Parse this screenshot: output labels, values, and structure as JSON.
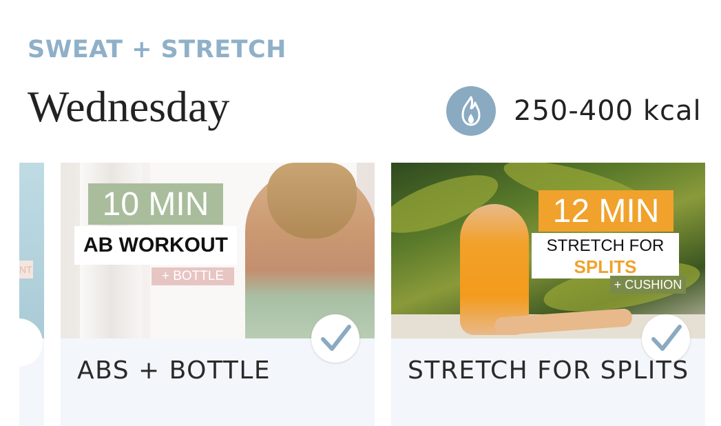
{
  "header": {
    "category": "SWEAT + STRETCH",
    "day": "Wednesday",
    "calories": "250-400 kcal",
    "calories_icon": "flame-icon"
  },
  "partial_card": {
    "label_fragment": "NT"
  },
  "workouts": [
    {
      "title": "ABS + BOTTLE",
      "thumb_duration": "10 MIN",
      "thumb_subtitle": "AB WORKOUT",
      "thumb_extra": "+ BOTTLE",
      "completed": true,
      "accent": "#a9bd9c"
    },
    {
      "title": "STRETCH FOR SPLITS",
      "thumb_duration": "12 MIN",
      "thumb_subtitle_line1": "STRETCH FOR",
      "thumb_subtitle_line2": "SPLITS",
      "thumb_extra": "+ CUSHION",
      "completed": true,
      "accent": "#f0a22c"
    }
  ],
  "colors": {
    "category": "#8fb0c8",
    "icon_bg": "#8aaac2",
    "check": "#8aaac2",
    "card_bg": "#f3f6fa"
  }
}
